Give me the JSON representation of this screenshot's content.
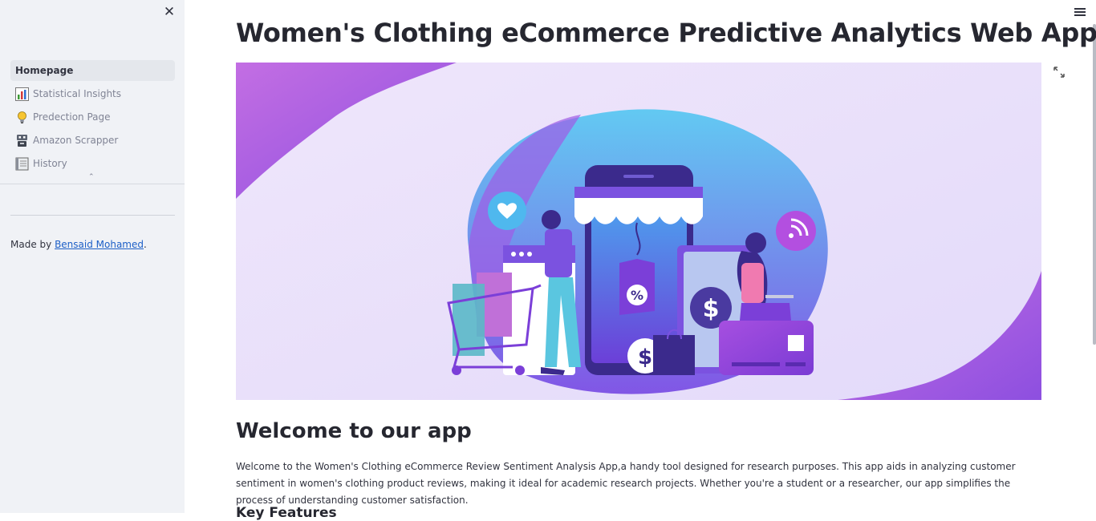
{
  "sidebar": {
    "nav_items": [
      {
        "label": "Homepage",
        "icon": "home",
        "active": true
      },
      {
        "label": "Statistical Insights",
        "icon": "bar-chart-icon",
        "active": false
      },
      {
        "label": "Predection Page",
        "icon": "lightbulb-icon",
        "active": false
      },
      {
        "label": "Amazon Scrapper",
        "icon": "robot-icon",
        "active": false
      },
      {
        "label": "History",
        "icon": "ledger-icon",
        "active": false
      }
    ],
    "made_by_prefix": "Made by ",
    "author_link": "Bensaid Mohamed",
    "made_by_suffix": "."
  },
  "main": {
    "title": "Women's Clothing eCommerce Predictive Analytics Web App",
    "welcome_heading": "Welcome to our app",
    "intro_text": "Welcome to the Women's Clothing eCommerce Review Sentiment Analysis App,a handy tool designed for research purposes. This app aids in analyzing customer sentiment in women's clothing product reviews, making it ideal for academic research projects. Whether you're a student or a researcher, our app simplifies the process of understanding customer satisfaction.",
    "next_heading": "Key Features"
  },
  "colors": {
    "sidebar_bg": "#f0f2f6",
    "accent_purple": "#7b3fe4",
    "accent_blue": "#4fb8ee",
    "accent_pink": "#c86ee0"
  }
}
